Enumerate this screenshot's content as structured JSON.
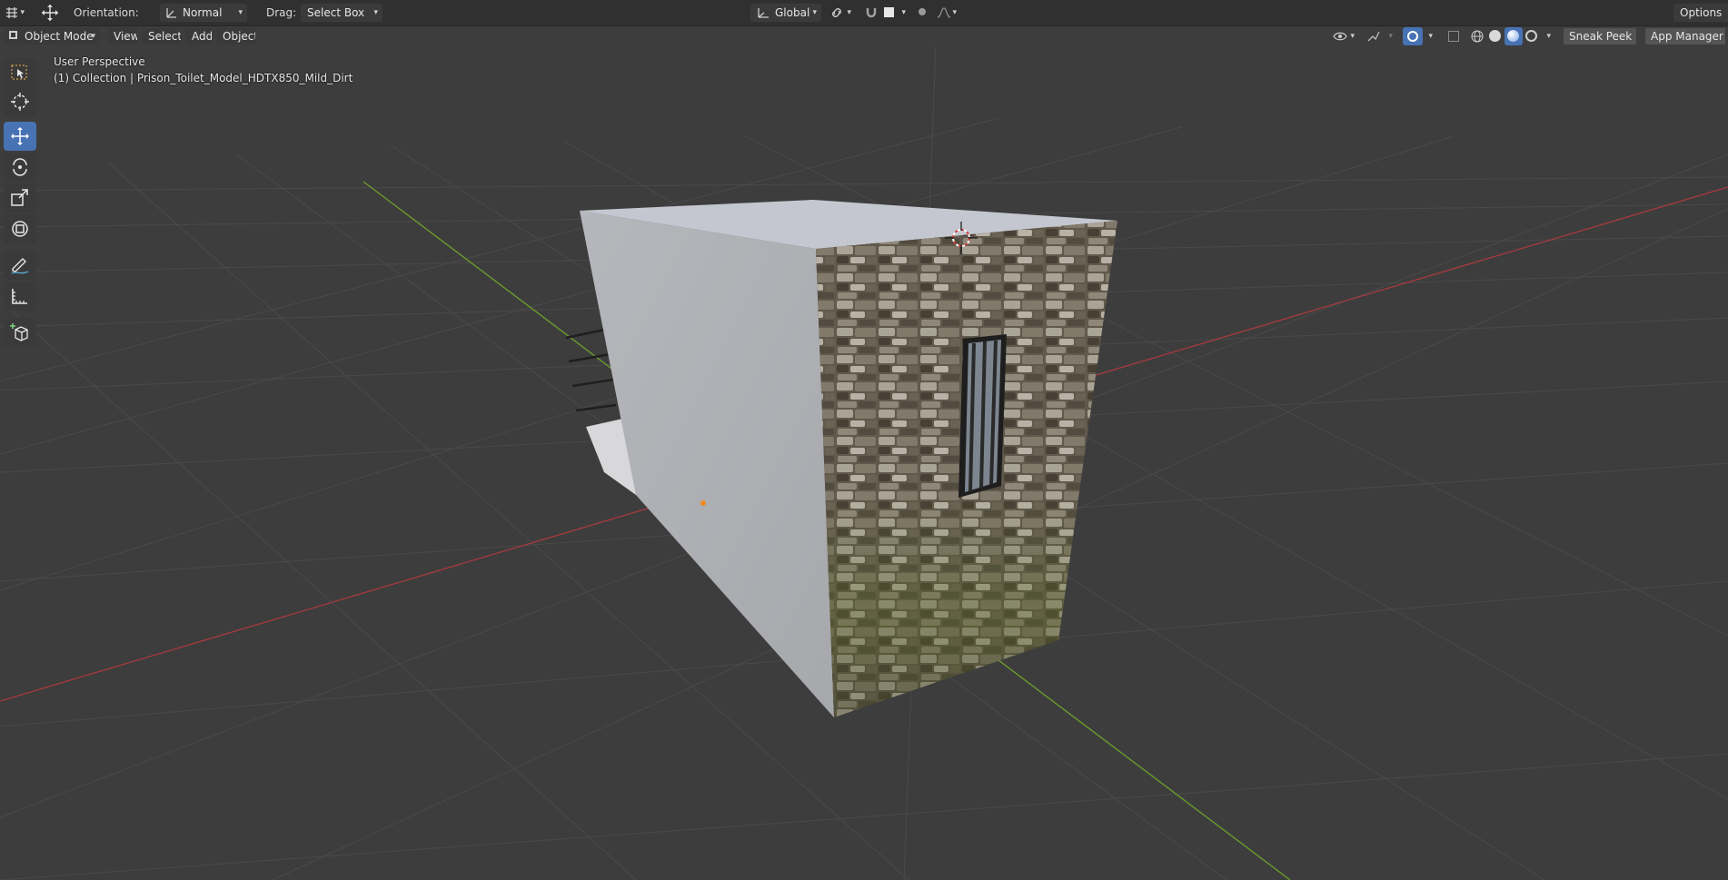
{
  "header": {
    "orientation_label": "Orientation:",
    "orientation_value": "Normal",
    "drag_label": "Drag:",
    "drag_value": "Select Box",
    "transform_space": "Global",
    "options_label": "Options"
  },
  "mode_bar": {
    "mode": "Object Mode",
    "menus": [
      "View",
      "Select",
      "Add",
      "Object"
    ],
    "sneak_peek": "Sneak Peek",
    "app_manager": "App Manager"
  },
  "viewport": {
    "view_name": "User Perspective",
    "collection_info": "(1) Collection | Prison_Toilet_Model_HDTX850_Mild_Dirt"
  },
  "toolbar": {
    "tools": [
      "select-box",
      "cursor",
      "move",
      "rotate",
      "scale",
      "transform",
      "annotate",
      "measure",
      "add-cube"
    ],
    "active_tool": "move"
  },
  "colors": {
    "background": "#3d3d3d",
    "grid": "#4a4a4a",
    "x_axis": "#a23a3f",
    "y_axis": "#6c9a2d",
    "accent": "#4772b3"
  }
}
